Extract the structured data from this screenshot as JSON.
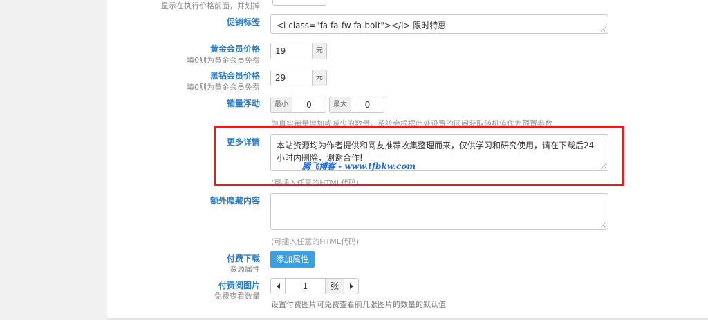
{
  "top_hint": "显示在执行价格前面，并划掉",
  "promo": {
    "label": "促销标签",
    "value": "<i class=\"fa fa-fw fa-bolt\"></i> 限时特惠"
  },
  "gold_price": {
    "label": "黄金会员价格",
    "sub": "填0则为黄金会员免费",
    "value": "19",
    "unit": "元"
  },
  "black_price": {
    "label": "黑钻会员价格",
    "sub": "填0则为黄金会员免费",
    "value": "29",
    "unit": "元"
  },
  "sales_float": {
    "label": "销量浮动",
    "min_label": "最小",
    "min_value": "0",
    "max_label": "最大",
    "max_value": "0",
    "hint": "为真实销量增加或减少的数量，系统会根据此处设置的区间获取随机值作为预置参数"
  },
  "more_details": {
    "label": "更多详情",
    "value": "本站资源均为作者提供和网友推荐收集整理而来，仅供学习和研究使用，请在下载后24小时内删除，谢谢合作!",
    "watermark": "腾飞博客 - www.tfbkw.com",
    "hint": "(可插入任意的HTML代码)"
  },
  "hidden_content": {
    "label": "额外隐藏内容",
    "value": "",
    "hint": "(可插入任意的HTML代码)"
  },
  "paid_download": {
    "label": "付费下载",
    "sub": "资源属性",
    "button": "添加属性"
  },
  "paid_images": {
    "label": "付费阅图片",
    "sub": "免费查看数量",
    "value": "1",
    "unit": "张",
    "hint": "设置付费图片可免费查看前几张图片的数量的默认值"
  },
  "colors": {
    "label_blue": "#2b7bbf",
    "highlight_red": "#e02020",
    "primary_button": "#3aa0e0"
  }
}
